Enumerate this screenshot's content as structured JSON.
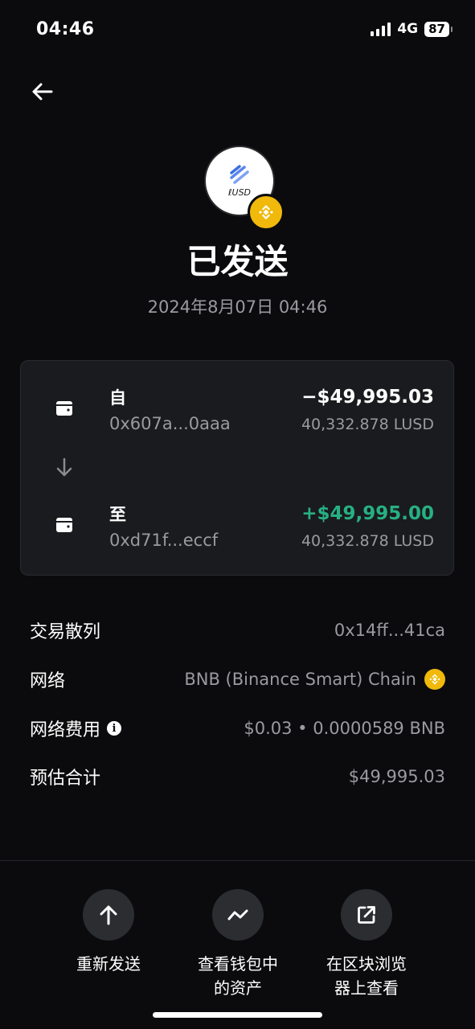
{
  "status_bar": {
    "time": "04:46",
    "network": "4G",
    "battery": "87"
  },
  "header": {
    "back_icon": "arrow-left-icon"
  },
  "token": {
    "label": "ℓUSD",
    "chain_icon": "bnb-icon",
    "badge_color": "#f0b90b"
  },
  "transaction": {
    "status": "已发送",
    "datetime": "2024年8月07日 04:46"
  },
  "transfer": {
    "from": {
      "label": "自",
      "address": "0x607a...0aaa",
      "amount": "−$49,995.03",
      "token_amount": "40,332.878 LUSD"
    },
    "to": {
      "label": "至",
      "address": "0xd71f...eccf",
      "amount": "+$49,995.00",
      "token_amount": "40,332.878 LUSD"
    },
    "positive_color": "#27b082"
  },
  "details": [
    {
      "label": "交易散列",
      "value": "0x14ff...41ca"
    },
    {
      "label": "网络",
      "value": "BNB (Binance Smart) Chain"
    },
    {
      "label": "网络费用",
      "value": "$0.03 • 0.0000589 BNB"
    },
    {
      "label": "预估合计",
      "value": "$49,995.03"
    }
  ],
  "actions": [
    {
      "label": "重新发送",
      "icon": "arrow-up-icon"
    },
    {
      "label": "查看钱包中\n的资产",
      "icon": "trend-chart-icon"
    },
    {
      "label": "在区块浏览\n器上查看",
      "icon": "external-link-icon"
    }
  ]
}
